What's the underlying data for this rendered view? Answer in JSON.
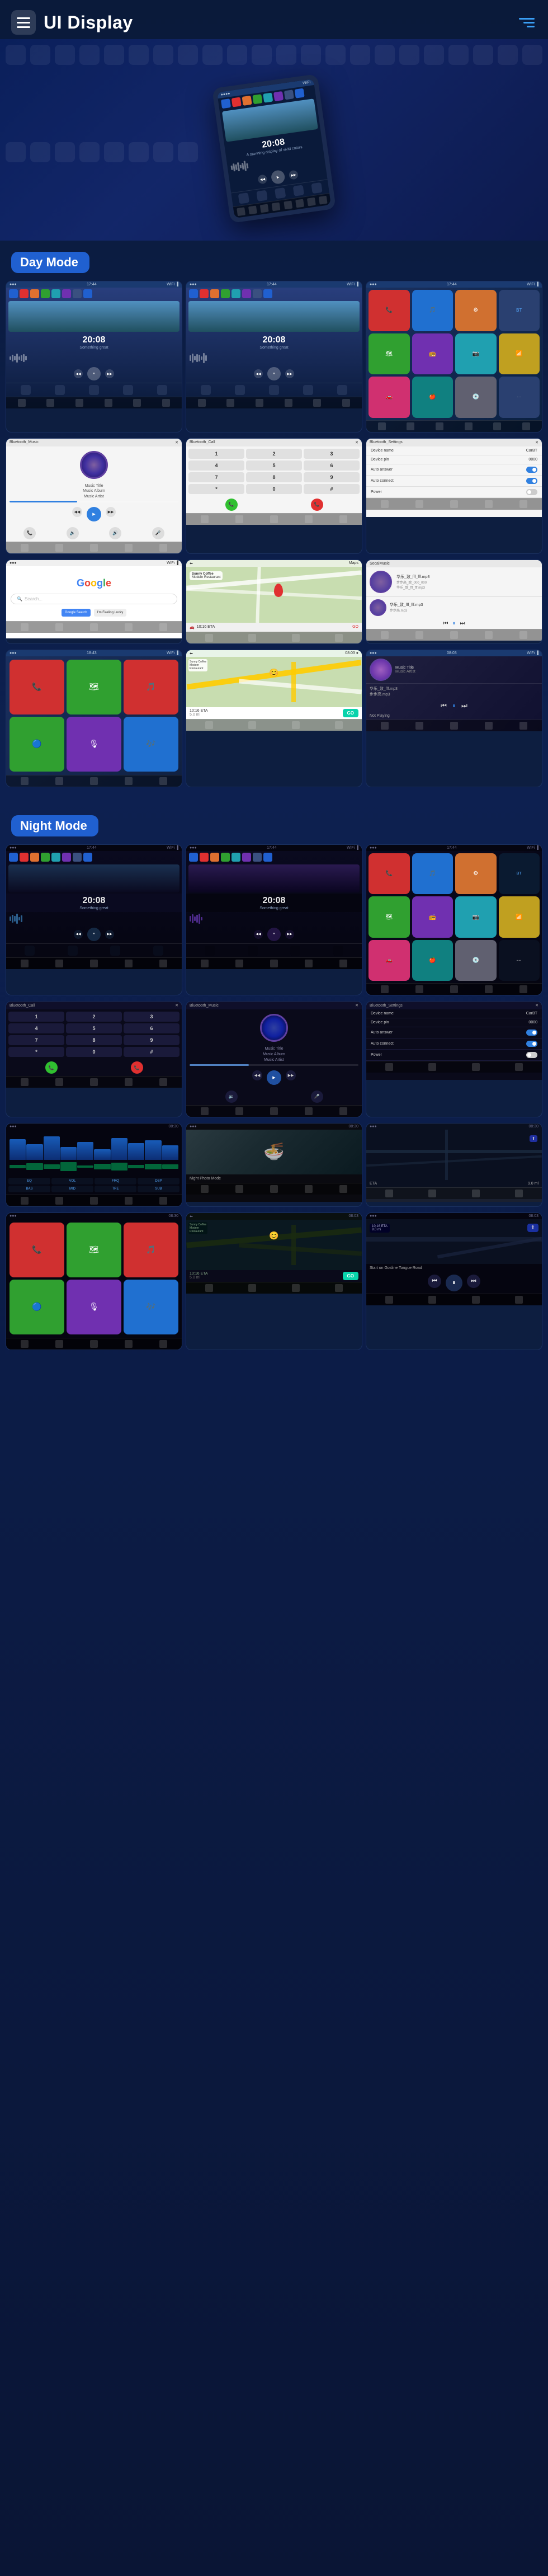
{
  "page": {
    "title": "UI Display",
    "menu_label": "menu",
    "nav_label": "navigation"
  },
  "hero": {
    "time": "20:08",
    "subtitle": "A stunning display of vivid colors"
  },
  "sections": {
    "day": {
      "label": "Day Mode",
      "screens": [
        {
          "type": "music_player",
          "time": "20:08",
          "subtitle": "Something great"
        },
        {
          "type": "music_player2",
          "time": "20:08",
          "subtitle": "Something great"
        },
        {
          "type": "app_launcher"
        },
        {
          "type": "bluetooth_music",
          "title": "Bluetooth_Music"
        },
        {
          "type": "bluetooth_call",
          "title": "Bluetooth_Call"
        },
        {
          "type": "bt_settings",
          "title": "Bluetooth_Settings"
        },
        {
          "type": "google"
        },
        {
          "type": "map"
        },
        {
          "type": "local_music",
          "title": "SocalMusic"
        },
        {
          "type": "carplay_apps"
        },
        {
          "type": "waze_nav"
        },
        {
          "type": "now_playing"
        }
      ]
    },
    "night": {
      "label": "Night Mode",
      "screens": [
        {
          "type": "night_music1",
          "time": "20:08"
        },
        {
          "type": "night_music2",
          "time": "20:08"
        },
        {
          "type": "night_apps"
        },
        {
          "type": "night_bt_call",
          "title": "Bluetooth_Call"
        },
        {
          "type": "night_bt_music",
          "title": "Bluetooth_Music"
        },
        {
          "type": "night_settings",
          "title": "Bluetooth_Settings"
        },
        {
          "type": "night_eq"
        },
        {
          "type": "night_photo"
        },
        {
          "type": "night_road"
        },
        {
          "type": "night_carplay"
        },
        {
          "type": "night_waze"
        },
        {
          "type": "night_nav2"
        }
      ]
    }
  },
  "music": {
    "title": "Music Title",
    "album": "Music Album",
    "artist": "Music Artist"
  },
  "settings_items": [
    {
      "label": "Device name",
      "value": "CarBT"
    },
    {
      "label": "Device pin",
      "value": "0000"
    },
    {
      "label": "Auto answer",
      "value": "toggle_on"
    },
    {
      "label": "Auto connect",
      "value": "toggle_on"
    },
    {
      "label": "Power",
      "value": "toggle_off"
    }
  ],
  "numpad": [
    [
      "1",
      "2",
      "3"
    ],
    [
      "4",
      "5",
      "6"
    ],
    [
      "7",
      "8",
      "9"
    ],
    [
      "*",
      "0",
      "#"
    ]
  ],
  "eta": {
    "time": "10:16 ETA",
    "distance": "5.0 mi",
    "direction": "Start on Gosline Tongue Road"
  },
  "colors": {
    "accent_blue": "#2060d0",
    "day_badge": "#2060d0",
    "night_badge": "#2060d0",
    "dark_bg": "#0a1530"
  }
}
